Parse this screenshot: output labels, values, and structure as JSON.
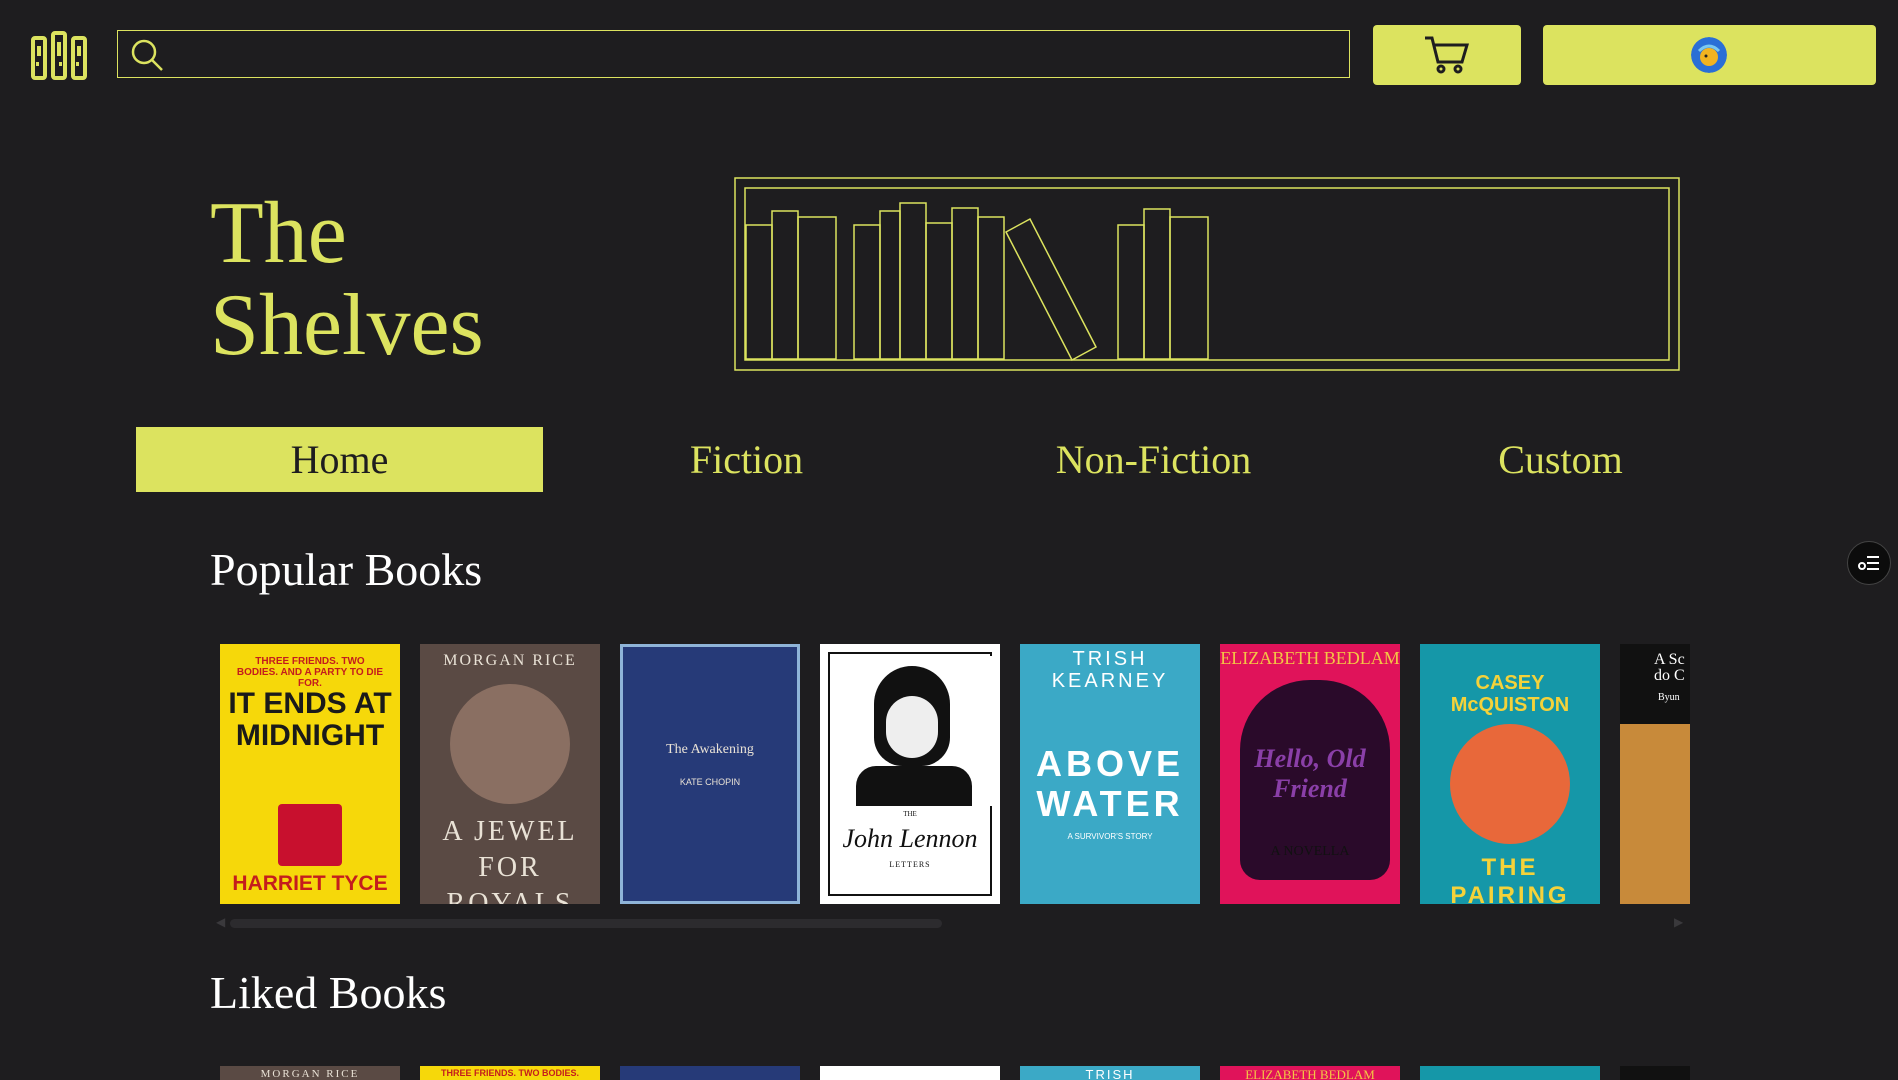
{
  "header": {
    "logo_icon": "bookshelf-logo-icon",
    "search": {
      "placeholder": "",
      "value": "",
      "icon": "search-icon"
    },
    "cart_icon": "cart-icon",
    "profile_icon": "avatar"
  },
  "hero": {
    "title": "The\nShelves",
    "illustration": "bookshelf-illustration"
  },
  "nav": {
    "tabs": [
      {
        "label": "Home",
        "active": true
      },
      {
        "label": "Fiction",
        "active": false
      },
      {
        "label": "Non-Fiction",
        "active": false
      },
      {
        "label": "Custom",
        "active": false
      }
    ]
  },
  "popular": {
    "title": "Popular Books",
    "books": [
      {
        "top": "THREE FRIENDS. TWO BODIES. AND A PARTY TO DIE FOR.",
        "title": "IT ENDS AT MIDNIGHT",
        "author": "HARRIET TYCE",
        "bg": "#f6d80a",
        "fg": "#1a1a1a"
      },
      {
        "top": "MORGAN RICE",
        "title": "A JEWEL FOR ROYALS",
        "author": "",
        "bg": "#5a4a44",
        "fg": "#e9e2d6"
      },
      {
        "top": "The Awakening",
        "title": "",
        "author": "KATE CHOPIN",
        "bg": "#263a78",
        "fg": "#e9e2d6"
      },
      {
        "top": "THE",
        "title": "John Lennon",
        "author": "LETTERS",
        "bg": "#ffffff",
        "fg": "#111111"
      },
      {
        "top": "TRISH KEARNEY",
        "title": "ABOVE WATER",
        "author": "A SURVIVOR'S STORY",
        "bg": "#3ba9c6",
        "fg": "#ffffff"
      },
      {
        "top": "ELIZABETH BEDLAM",
        "title": "Hello, Old Friend",
        "author": "A NOVELLA",
        "bg": "#e0135a",
        "fg": "#f3c645"
      },
      {
        "top": "CASEY McQUISTON",
        "title": "THE PAIRING",
        "author": "",
        "bg": "#1597a8",
        "fg": "#f4d23a"
      },
      {
        "top": "A Sc do C",
        "title": "Byun",
        "author": "",
        "bg": "#c88a3a",
        "fg": "#111111"
      }
    ]
  },
  "liked": {
    "title": "Liked Books",
    "books": [
      {
        "top": "MORGAN RICE",
        "bg": "#5a4a44",
        "fg": "#e9e2d6"
      },
      {
        "top": "THREE FRIENDS. TWO BODIES.",
        "bg": "#f6d80a",
        "fg": "#1a1a1a"
      },
      {
        "top": "",
        "bg": "#263a78",
        "fg": "#e9e2d6"
      },
      {
        "top": "",
        "bg": "#ffffff",
        "fg": "#111111"
      },
      {
        "top": "TRISH",
        "bg": "#3ba9c6",
        "fg": "#ffffff"
      },
      {
        "top": "ELIZABETH BEDLAM",
        "bg": "#e0135a",
        "fg": "#f3c645"
      },
      {
        "top": "",
        "bg": "#1597a8",
        "fg": "#f4d23a"
      },
      {
        "top": "",
        "bg": "#111111",
        "fg": "#ffffff"
      }
    ]
  },
  "float_button": {
    "icon": "list-settings-icon"
  },
  "colors": {
    "accent": "#dce35f",
    "background": "#1e1d1f",
    "heading": "#ffffff"
  }
}
